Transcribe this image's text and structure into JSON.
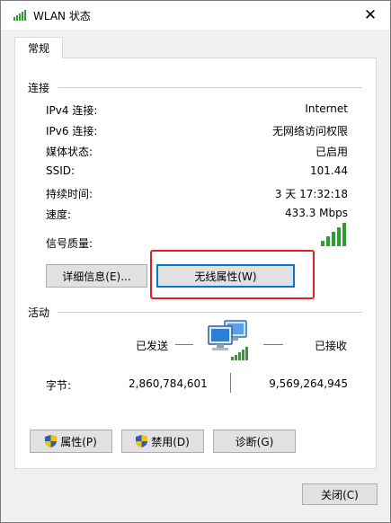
{
  "window": {
    "title": "WLAN 状态",
    "close_glyph": "✕"
  },
  "tabs": [
    {
      "label": "常规",
      "selected": true
    }
  ],
  "connection": {
    "group_title": "连接",
    "rows": [
      {
        "label": "IPv4 连接:",
        "value": "Internet"
      },
      {
        "label": "IPv6 连接:",
        "value": "无网络访问权限"
      },
      {
        "label": "媒体状态:",
        "value": "已启用"
      },
      {
        "label": "SSID:",
        "value": "101.44"
      },
      {
        "label": "持续时间:",
        "value": "3 天 17:32:18"
      },
      {
        "label": "速度:",
        "value": "433.3 Mbps"
      }
    ],
    "signal_label": "信号质量:",
    "signal_bars_filled": 5,
    "signal_bars_total": 5,
    "details_button": "详细信息(E)...",
    "wireless_props_button": "无线属性(W)"
  },
  "activity": {
    "group_title": "活动",
    "sent_label": "已发送",
    "received_label": "已接收",
    "bytes_label": "字节:",
    "bytes_sent": "2,860,784,601",
    "bytes_received": "9,569,264,945"
  },
  "bottom_buttons": {
    "properties": "属性(P)",
    "disable": "禁用(D)",
    "diagnose": "诊断(G)"
  },
  "close_button": "关闭(C)",
  "colors": {
    "highlight": "#e02020",
    "focus_border": "#0078d7",
    "signal_green": "#2e9e2e"
  }
}
